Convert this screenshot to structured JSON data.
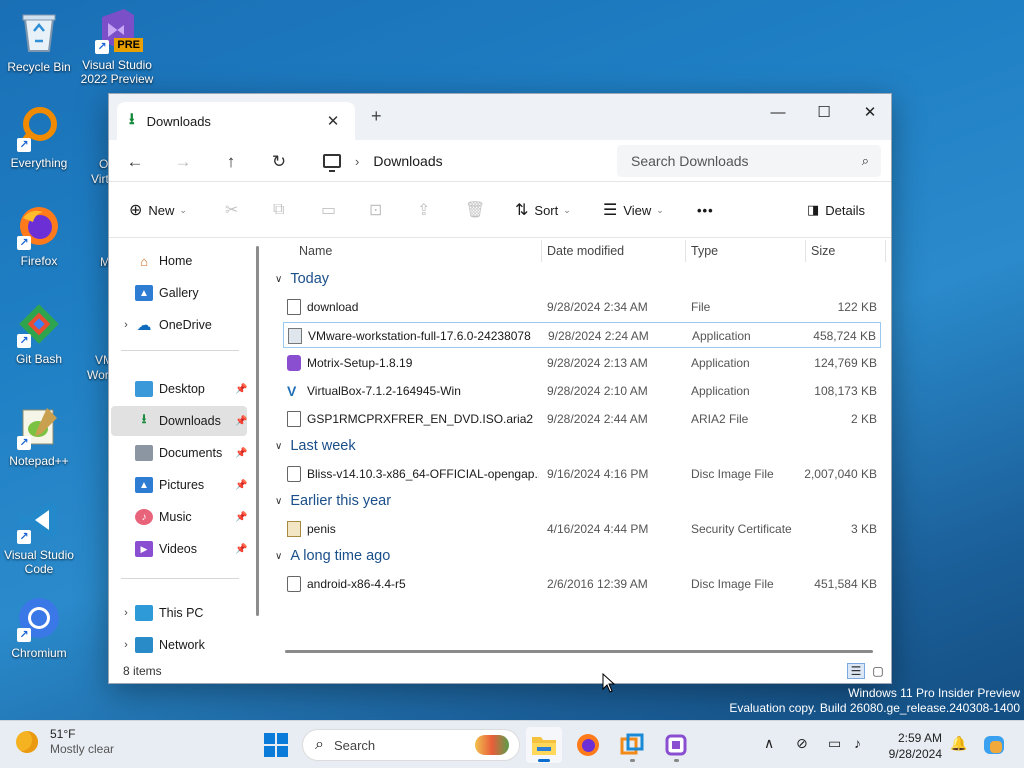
{
  "desktop": {
    "icons": [
      {
        "label": "Recycle Bin",
        "icon": "recycle-bin-icon"
      },
      {
        "label": "Visual Studio 2022 Preview",
        "icon": "visual-studio-preview-icon",
        "badge": "PRE"
      },
      {
        "label": "Everything",
        "icon": "everything-search-icon"
      },
      {
        "label": "Firefox",
        "icon": "firefox-icon"
      },
      {
        "label": "Git Bash",
        "icon": "git-bash-icon"
      },
      {
        "label": "Notepad++",
        "icon": "notepad-plus-plus-icon"
      },
      {
        "label": "Visual Studio Code",
        "icon": "vscode-icon"
      },
      {
        "label": "Chromium",
        "icon": "chromium-icon"
      }
    ],
    "partial_labels": [
      "O",
      "Virt",
      "M",
      "VM",
      "Wor"
    ]
  },
  "explorer": {
    "tab_title": "Downloads",
    "tab_close": "✕",
    "new_tab": "+",
    "window_controls": {
      "minimize": "—",
      "maximize": "☐",
      "close": "✕"
    },
    "address": {
      "breadcrumb": "Downloads"
    },
    "search": {
      "placeholder": "Search Downloads"
    },
    "toolbar": {
      "new_label": "New",
      "sort_label": "Sort",
      "view_label": "View",
      "more_label": "•••",
      "details_label": "Details"
    },
    "nav": {
      "items": [
        {
          "label": "Home",
          "icon": "home-icon"
        },
        {
          "label": "Gallery",
          "icon": "gallery-icon"
        },
        {
          "label": "OneDrive",
          "icon": "onedrive-icon",
          "expandable": true
        },
        {
          "label": "Desktop",
          "icon": "desktop-folder-icon",
          "pinned": true
        },
        {
          "label": "Downloads",
          "icon": "downloads-folder-icon",
          "pinned": true,
          "selected": true
        },
        {
          "label": "Documents",
          "icon": "documents-folder-icon",
          "pinned": true
        },
        {
          "label": "Pictures",
          "icon": "pictures-folder-icon",
          "pinned": true
        },
        {
          "label": "Music",
          "icon": "music-folder-icon",
          "pinned": true
        },
        {
          "label": "Videos",
          "icon": "videos-folder-icon",
          "pinned": true
        },
        {
          "label": "This PC",
          "icon": "this-pc-icon",
          "expandable": true
        },
        {
          "label": "Network",
          "icon": "network-icon",
          "expandable": true
        }
      ]
    },
    "columns": {
      "name": "Name",
      "date": "Date modified",
      "type": "Type",
      "size": "Size"
    },
    "groups": [
      {
        "title": "Today",
        "files": [
          {
            "name": "download",
            "date": "9/28/2024 2:34 AM",
            "type": "File",
            "size": "122 KB",
            "icon": "blank-file-icon"
          },
          {
            "name": "VMware-workstation-full-17.6.0-24238078",
            "date": "9/28/2024 2:24 AM",
            "type": "Application",
            "size": "458,724 KB",
            "icon": "vmware-installer-icon"
          },
          {
            "name": "Motrix-Setup-1.8.19",
            "date": "9/28/2024 2:13 AM",
            "type": "Application",
            "size": "124,769 KB",
            "icon": "motrix-installer-icon"
          },
          {
            "name": "VirtualBox-7.1.2-164945-Win",
            "date": "9/28/2024 2:10 AM",
            "type": "Application",
            "size": "108,173 KB",
            "icon": "virtualbox-installer-icon"
          },
          {
            "name": "GSP1RMCPRXFRER_EN_DVD.ISO.aria2",
            "date": "9/28/2024 2:44 AM",
            "type": "ARIA2 File",
            "size": "2 KB",
            "icon": "blank-file-icon"
          }
        ]
      },
      {
        "title": "Last week",
        "files": [
          {
            "name": "Bliss-v14.10.3-x86_64-OFFICIAL-opengap...",
            "date": "9/16/2024 4:16 PM",
            "type": "Disc Image File",
            "size": "2,007,040 KB",
            "icon": "disc-image-icon"
          }
        ]
      },
      {
        "title": "Earlier this year",
        "files": [
          {
            "name": "penis",
            "date": "4/16/2024 4:44 PM",
            "type": "Security Certificate",
            "size": "3 KB",
            "icon": "certificate-icon"
          }
        ]
      },
      {
        "title": "A long time ago",
        "files": [
          {
            "name": "android-x86-4.4-r5",
            "date": "2/6/2016 12:39 AM",
            "type": "Disc Image File",
            "size": "451,584 KB",
            "icon": "disc-image-icon"
          }
        ]
      }
    ],
    "status": {
      "item_count": "8 items"
    }
  },
  "watermark": {
    "line1": "Windows 11 Pro Insider Preview",
    "line2": "Evaluation copy. Build 26080.ge_release.240308-1400"
  },
  "taskbar": {
    "weather": {
      "temp": "51°F",
      "condition": "Mostly clear"
    },
    "search_placeholder": "Search",
    "clock": {
      "time": "2:59 AM",
      "date": "9/28/2024"
    }
  },
  "colors": {
    "accent": "#0a6ccf",
    "group_header": "#1b4f8a",
    "selection": "#e1e1e1"
  }
}
